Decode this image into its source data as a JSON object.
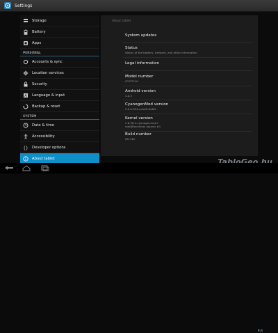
{
  "actionbar": {
    "title": "Settings",
    "icon": "settings-gear-icon"
  },
  "sidebar": {
    "items": [
      {
        "label": "Storage",
        "icon": "storage-icon"
      },
      {
        "label": "Battery",
        "icon": "battery-icon"
      },
      {
        "label": "Apps",
        "icon": "apps-icon"
      }
    ],
    "personal_header": "PERSONAL",
    "personal": [
      {
        "label": "Accounts & sync",
        "icon": "sync-icon"
      },
      {
        "label": "Location services",
        "icon": "location-icon"
      },
      {
        "label": "Security",
        "icon": "lock-icon"
      },
      {
        "label": "Language & input",
        "icon": "language-icon"
      },
      {
        "label": "Backup & reset",
        "icon": "backup-icon"
      }
    ],
    "system_header": "SYSTEM",
    "system": [
      {
        "label": "Date & time",
        "icon": "clock-icon"
      },
      {
        "label": "Accessibility",
        "icon": "accessibility-icon"
      },
      {
        "label": "Developer options",
        "icon": "developer-braces-icon"
      },
      {
        "label": "About tablet",
        "icon": "info-icon",
        "active": true
      }
    ]
  },
  "content": {
    "header": "About tablet",
    "system_updates": "System updates",
    "status_title": "Status",
    "status_sub": "Status of the battery, network, and other information",
    "legal": "Legal information",
    "model_title": "Model number",
    "model_value": "GT-P7510",
    "android_title": "Android version",
    "android_value": "4.0.3",
    "cm_title": "CyanogenMod version",
    "cm_value": "9.0.0-RC0-p4wifi-KANG",
    "kernel_title": "Kernel version",
    "kernel_value": "2.6.36.4-cyanogenmod+\nroot@localhost ubuntu #1",
    "build_title": "Build number",
    "build_value": "IML74K"
  },
  "watermark": "TabloGeo.hu",
  "status_bar": {
    "time": "9:4"
  }
}
